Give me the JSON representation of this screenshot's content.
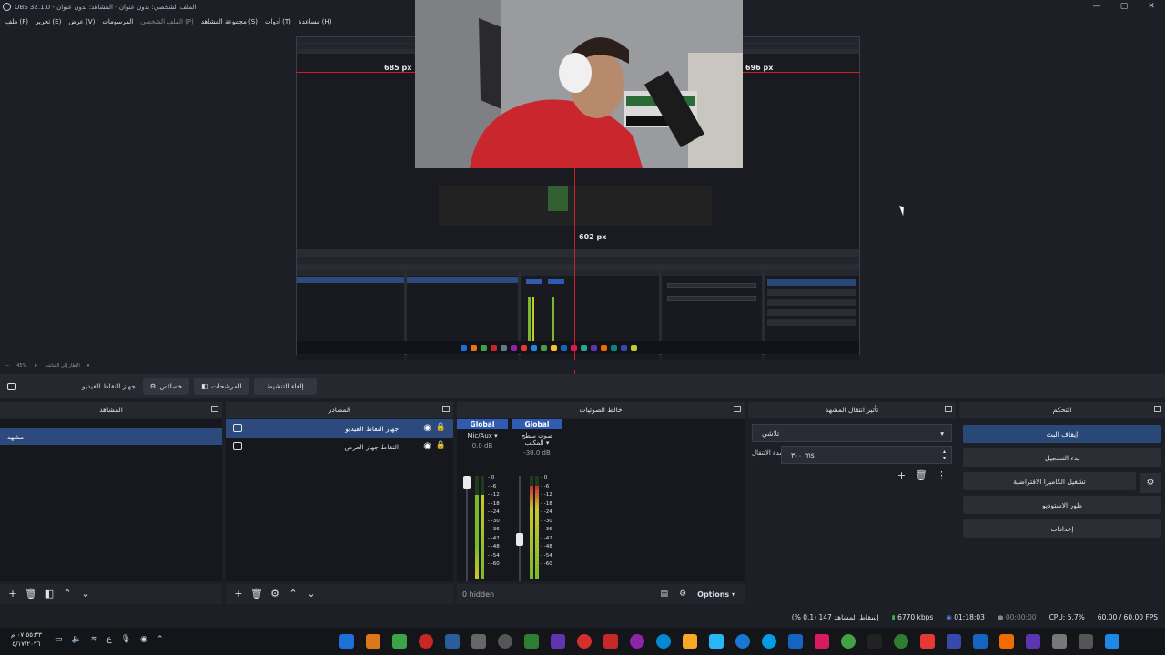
{
  "window": {
    "title": "OBS 32.1.0 - الملف الشخصي: بدون عنوان - المشاهد: بدون عنوان",
    "controls": {
      "minimize": "—",
      "maximize": "▢",
      "close": "✕"
    }
  },
  "menu": [
    "ملف (F)",
    "تحرير (E)",
    "عرض (V)",
    "المرسومات",
    "الملف الشخصي (P)",
    "مجموعة المشاهد (S)",
    "أدوات (T)",
    "مساعدة (H)"
  ],
  "preview": {
    "measure_left": "685 px",
    "measure_right": "696 px",
    "measure_bottom": "602 px",
    "zoom": "45%",
    "zoom_label": "الإطار إلى الشاشة"
  },
  "source_toolbar": {
    "device_label": "جهاز التقاط الفيديو",
    "properties": "خصائص",
    "filters": "المرشحات",
    "deactivate": "إلغاء التنشيط"
  },
  "docks": {
    "scenes": {
      "title": "المشاهد",
      "items": [
        "مشهد"
      ]
    },
    "sources": {
      "title": "المصادر",
      "items": [
        {
          "label": "جهاز التقاط الفيديو",
          "icon": "camera-icon"
        },
        {
          "label": "التقاط جهاز العرض",
          "icon": "monitor-icon"
        }
      ]
    },
    "mixer": {
      "title": "خالط الصوتيات",
      "channels": [
        {
          "badge": "Global",
          "name": "Mic/Aux",
          "db": "0.0 dB",
          "level": 0.82,
          "fader": 1.0
        },
        {
          "badge": "Global",
          "name": "صوت سطح المكتب",
          "db": "-30.0 dB",
          "level": 0.9,
          "fader": 0.55
        }
      ],
      "scale": [
        "0",
        "-6",
        "-12",
        "-18",
        "-24",
        "-30",
        "-36",
        "-42",
        "-48",
        "-54",
        "-60"
      ],
      "hidden": "0 hidden",
      "options": "Options"
    },
    "transitions": {
      "title": "تأثير انتقال المشهد",
      "type": "تلاشي",
      "duration_label": "مدة الانتقال",
      "duration_value": "٣٠٠ ms"
    },
    "controls": {
      "title": "التحكم",
      "buttons": [
        "إيقاف البث",
        "بدء التسجيل",
        "تشغيل الكاميرا الافتراضية",
        "طور الاستوديو",
        "إعدادات"
      ]
    }
  },
  "status": {
    "dropped": "إسقاط المشاهد 147 (0.1 %)",
    "bitrate": "6770 kbps",
    "stream_time": "01:18:03",
    "record_time": "00:00:00",
    "cpu": "CPU: 5.7%",
    "fps": "60.00 / 60.00 FPS"
  },
  "taskbar": {
    "time": "٠٧:٥٥:٣٣ م",
    "date": "٥/١٧/٢٠٢٦",
    "lang": "ع"
  },
  "colors": {
    "accent": "#2f5cb2",
    "selection": "#2c4a7d",
    "measure": "#cc1f28"
  }
}
